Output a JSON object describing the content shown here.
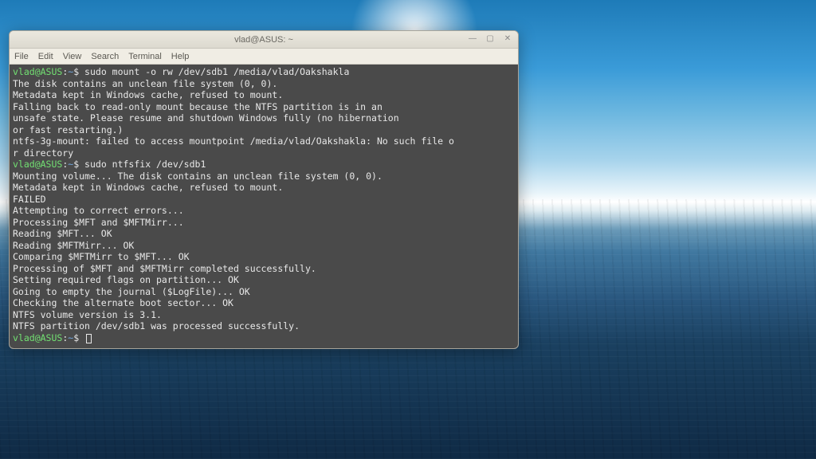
{
  "desktop": {
    "wallpaper_desc": "ocean-sunlight"
  },
  "terminal": {
    "title": "vlad@ASUS: ~",
    "menu": {
      "file": "File",
      "edit": "Edit",
      "view": "View",
      "search": "Search",
      "terminal": "Terminal",
      "help": "Help"
    },
    "controls": {
      "minimize": "—",
      "maximize": "▢",
      "close": "✕"
    },
    "prompt": {
      "user_host": "vlad@ASUS",
      "separator": ":",
      "path": "~",
      "symbol": "$"
    },
    "session": [
      {
        "type": "cmd",
        "text": "sudo mount -o rw /dev/sdb1 /media/vlad/Oakshakla"
      },
      {
        "type": "out",
        "text": "The disk contains an unclean file system (0, 0)."
      },
      {
        "type": "out",
        "text": "Metadata kept in Windows cache, refused to mount."
      },
      {
        "type": "out",
        "text": "Falling back to read-only mount because the NTFS partition is in an"
      },
      {
        "type": "out",
        "text": "unsafe state. Please resume and shutdown Windows fully (no hibernation"
      },
      {
        "type": "out",
        "text": "or fast restarting.)"
      },
      {
        "type": "out",
        "text": "ntfs-3g-mount: failed to access mountpoint /media/vlad/Oakshakla: No such file o"
      },
      {
        "type": "out",
        "text": "r directory"
      },
      {
        "type": "cmd",
        "text": "sudo ntfsfix /dev/sdb1"
      },
      {
        "type": "out",
        "text": "Mounting volume... The disk contains an unclean file system (0, 0)."
      },
      {
        "type": "out",
        "text": "Metadata kept in Windows cache, refused to mount."
      },
      {
        "type": "out",
        "text": "FAILED"
      },
      {
        "type": "out",
        "text": "Attempting to correct errors..."
      },
      {
        "type": "out",
        "text": "Processing $MFT and $MFTMirr..."
      },
      {
        "type": "out",
        "text": "Reading $MFT... OK"
      },
      {
        "type": "out",
        "text": "Reading $MFTMirr... OK"
      },
      {
        "type": "out",
        "text": "Comparing $MFTMirr to $MFT... OK"
      },
      {
        "type": "out",
        "text": "Processing of $MFT and $MFTMirr completed successfully."
      },
      {
        "type": "out",
        "text": "Setting required flags on partition... OK"
      },
      {
        "type": "out",
        "text": "Going to empty the journal ($LogFile)... OK"
      },
      {
        "type": "out",
        "text": "Checking the alternate boot sector... OK"
      },
      {
        "type": "out",
        "text": "NTFS volume version is 3.1."
      },
      {
        "type": "out",
        "text": "NTFS partition /dev/sdb1 was processed successfully."
      },
      {
        "type": "cmd",
        "text": ""
      }
    ]
  }
}
